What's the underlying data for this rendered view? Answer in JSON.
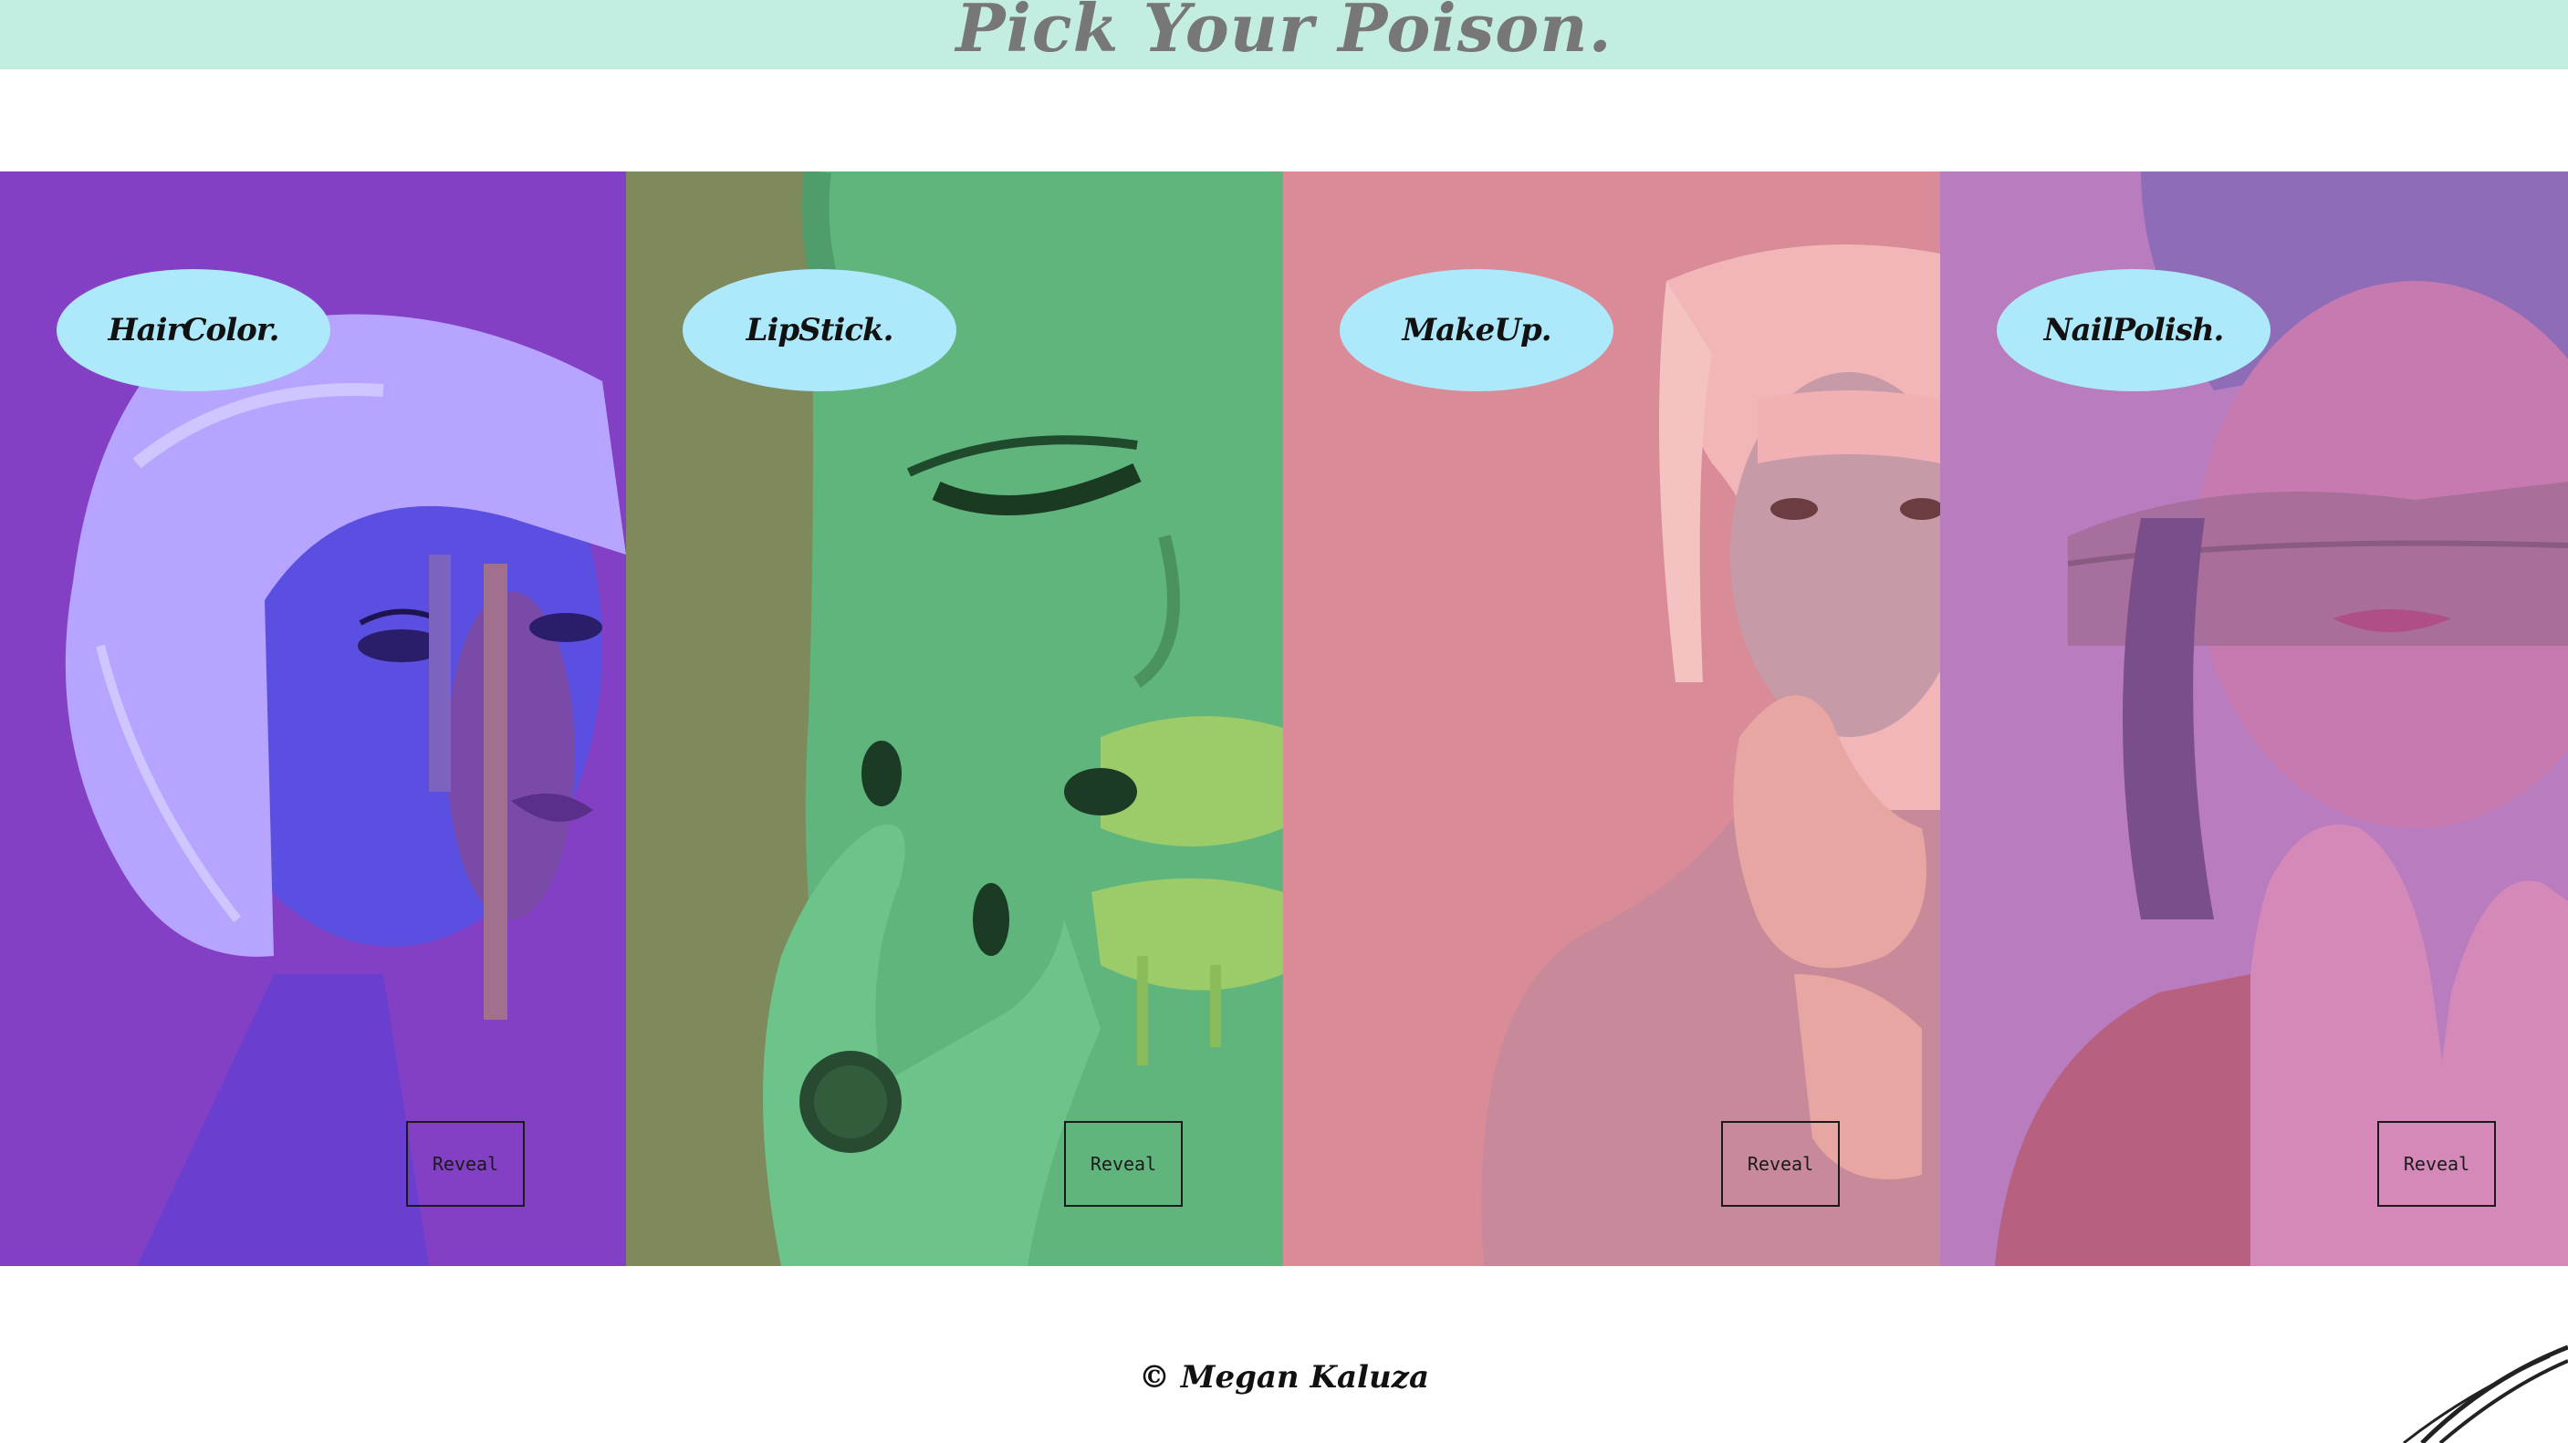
{
  "header": {
    "title": "Pick Your Poison."
  },
  "panels": [
    {
      "label": "HairColor.",
      "button": "Reveal",
      "tint": "#8440c4",
      "art": "haircolor"
    },
    {
      "label": "LipStick.",
      "button": "Reveal",
      "tint": "#5fb57c",
      "art": "lipstick"
    },
    {
      "label": "MakeUp.",
      "button": "Reveal",
      "tint": "#d98c98",
      "art": "makeup"
    },
    {
      "label": "NailPolish.",
      "button": "Reveal",
      "tint": "#b87cbf",
      "art": "nailpolish"
    }
  ],
  "footer": {
    "copyright": "© Megan Kaluza"
  },
  "colors": {
    "header_bg": "#c3ede0",
    "title_text": "#777777",
    "oval_bg": "#aee8fb"
  }
}
